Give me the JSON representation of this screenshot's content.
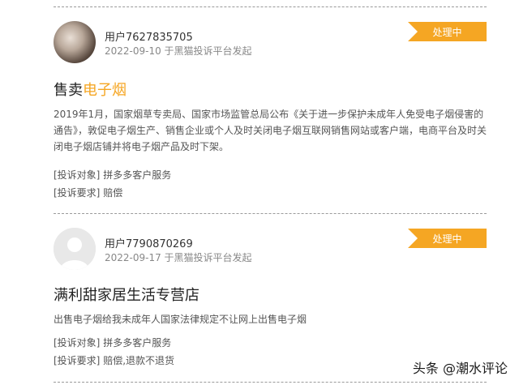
{
  "complaints": [
    {
      "user": "用户7627835705",
      "date_platform": "2022-09-10 于黑猫投诉平台发起",
      "status": "处理中",
      "title_prefix": "售卖",
      "title_highlight": "电子烟",
      "body": "2019年1月，国家烟草专卖局、国家市场监管总局公布《关于进一步保护未成年人免受电子烟侵害的通告》，敦促电子烟生产、销售企业或个人及时关闭电子烟互联网销售网站或客户端，电商平台及时关闭电子烟店铺并将电子烟产品及时下架。",
      "target_label": "[投诉对象]",
      "target_value": "拼多多客户服务",
      "request_label": "[投诉要求]",
      "request_value": "赔偿"
    },
    {
      "user": "用户7790870269",
      "date_platform": "2022-09-17 于黑猫投诉平台发起",
      "status": "处理中",
      "title_prefix": "满利甜家居生活专营店",
      "title_highlight": "",
      "body": "出售电子烟给我未成年人国家法律规定不让网上出售电子烟",
      "target_label": "[投诉对象]",
      "target_value": "拼多多客户服务",
      "request_label": "[投诉要求]",
      "request_value": "赔偿,退款不退货"
    }
  ],
  "watermark": "头条 @潮水评论",
  "colors": {
    "accent": "#f5a623"
  }
}
